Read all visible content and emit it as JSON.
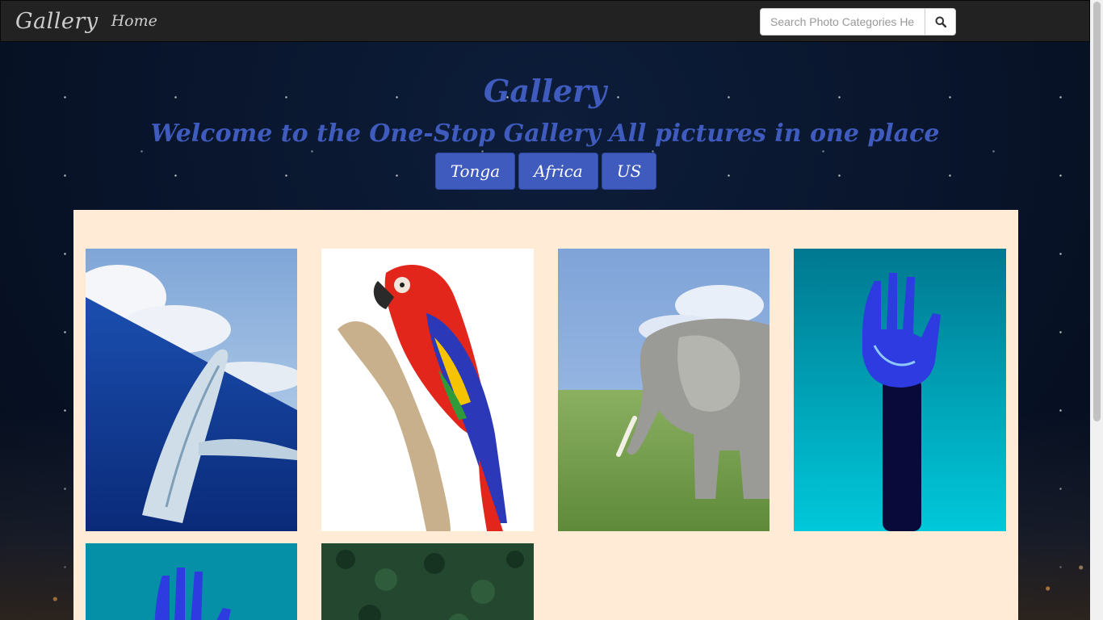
{
  "navbar": {
    "brand": "Gallery",
    "home_link": "Home",
    "search_placeholder": "Search Photo Categories Here"
  },
  "hero": {
    "title": "Gallery",
    "subtitle": "Welcome to the One-Stop Gallery All pictures in one place",
    "categories": [
      "Tonga",
      "Africa",
      "US"
    ]
  },
  "gallery": {
    "photos": [
      {
        "subject": "whale"
      },
      {
        "subject": "parrot"
      },
      {
        "subject": "elephant"
      },
      {
        "subject": "robotic hand"
      },
      {
        "subject": "robotic hand"
      },
      {
        "subject": "forest"
      }
    ]
  },
  "colors": {
    "accent": "#3f5bbd",
    "navbar": "#222222",
    "panel": "#ffebd6"
  }
}
